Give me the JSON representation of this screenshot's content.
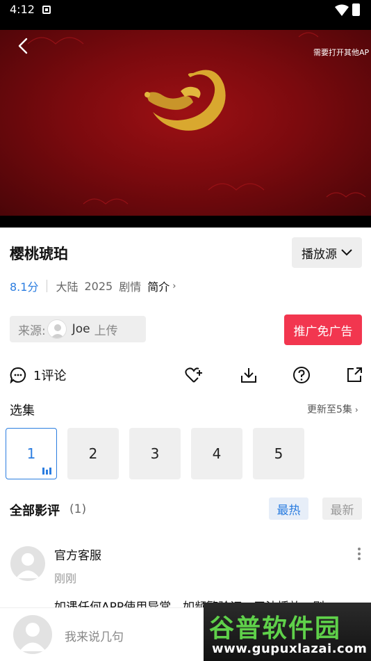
{
  "status_bar": {
    "time": "4:12"
  },
  "player": {
    "hint_text": "需要打开其他AP"
  },
  "video": {
    "title": "樱桃琥珀",
    "source_button": "播放源"
  },
  "meta": {
    "score": "8.1分",
    "region": "大陆",
    "year": "2025",
    "genre": "剧情",
    "intro_label": "简介"
  },
  "uploader": {
    "prefix": "来源:",
    "name": "Joe",
    "suffix": "上传"
  },
  "promo_button": "推广免广告",
  "actions": {
    "comment_label": "1评论"
  },
  "episodes": {
    "label": "选集",
    "update": "更新至5集",
    "items": [
      "1",
      "2",
      "3",
      "4",
      "5"
    ],
    "selected": "1"
  },
  "reviews": {
    "label": "全部影评",
    "count": "(1)",
    "sort_hot": "最热",
    "sort_new": "最新"
  },
  "comments": [
    {
      "author": "官方客服",
      "time": "刚刚",
      "text": "如遇任何APP使用异常，如频繁验证、无法播放，则"
    }
  ],
  "input": {
    "placeholder": "我来说几句"
  },
  "watermark": {
    "title": "谷普软件园",
    "url": "www.gupuxlazai.com"
  },
  "colors": {
    "accent": "#2b7de0",
    "promo": "#f2364f",
    "player_red": "#8b0c10"
  }
}
